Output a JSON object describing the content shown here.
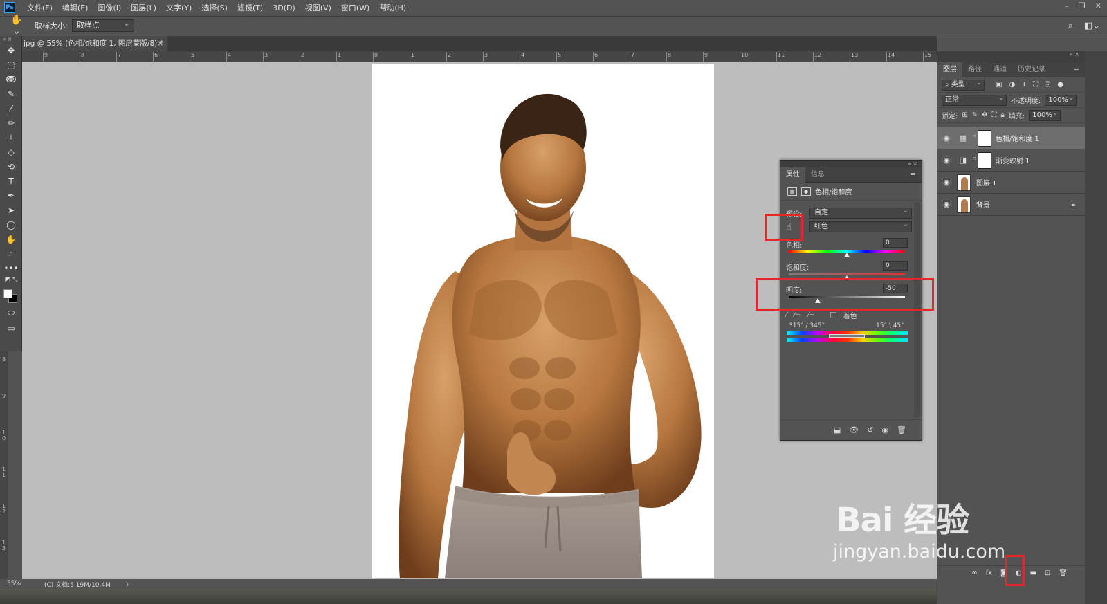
{
  "menu": {
    "logo": "Ps",
    "items": [
      "文件(F)",
      "编辑(E)",
      "图像(I)",
      "图层(L)",
      "文字(Y)",
      "选择(S)",
      "滤镜(T)",
      "3D(D)",
      "视图(V)",
      "窗口(W)",
      "帮助(H)"
    ],
    "window_controls": [
      "–",
      "❐",
      "✕"
    ]
  },
  "options": {
    "sample_size_label": "取样大小:",
    "sample_size_value": "取样点"
  },
  "document_tab": {
    "title": "jpg @ 55% (色相/饱和度 1, 图层蒙版/8) *",
    "close": "×"
  },
  "ruler": {
    "h_labels": [
      "9",
      "8",
      "7",
      "6",
      "5",
      "4",
      "3",
      "2",
      "1",
      "0",
      "1",
      "2",
      "3",
      "4",
      "5",
      "6",
      "7",
      "8",
      "9",
      "10",
      "11",
      "12",
      "13",
      "14",
      "15"
    ],
    "v_labels": [
      "8",
      "9",
      "1\n0",
      "1\n1",
      "1\n2",
      "1\n3"
    ]
  },
  "status": {
    "zoom": "55%",
    "doc_info": "(C) 文档:5.19M/10.4M",
    "arrow": "〉"
  },
  "layers_panel": {
    "tabs": [
      "图层",
      "路径",
      "通道",
      "历史记录"
    ],
    "filter_kind": "类型",
    "blend_mode": "正常",
    "opacity_label": "不透明度:",
    "opacity_value": "100%",
    "lock_label": "锁定:",
    "fill_label": "填充:",
    "fill_value": "100%",
    "layers": [
      {
        "name": "色相/饱和度 1",
        "type": "adjustment-hue"
      },
      {
        "name": "渐变映射 1",
        "type": "adjustment-gradient"
      },
      {
        "name": "图层 1",
        "type": "pixel"
      },
      {
        "name": "背景",
        "type": "background"
      }
    ]
  },
  "properties_panel": {
    "tabs": [
      "属性",
      "信息"
    ],
    "title": "色相/饱和度",
    "preset_label": "预设:",
    "preset_value": "自定",
    "channel_value": "红色",
    "hue_label": "色相:",
    "hue_value": "0",
    "hue_level": 0,
    "saturation_label": "饱和度:",
    "saturation_value": "0",
    "saturation_level": 0,
    "lightness_label": "明度:",
    "lightness_value": "-50",
    "lightness_level": -50,
    "colorize_label": "着色",
    "range_left": "315° / 345°",
    "range_right": "15° \\ 45°"
  },
  "watermark": {
    "brand": "Bai  经验",
    "url": "jingyan.baidu.com"
  },
  "colors": {
    "annotation": "#e8262a",
    "ui_dark": "#535353",
    "canvas_bg": "#bdbdbd"
  }
}
